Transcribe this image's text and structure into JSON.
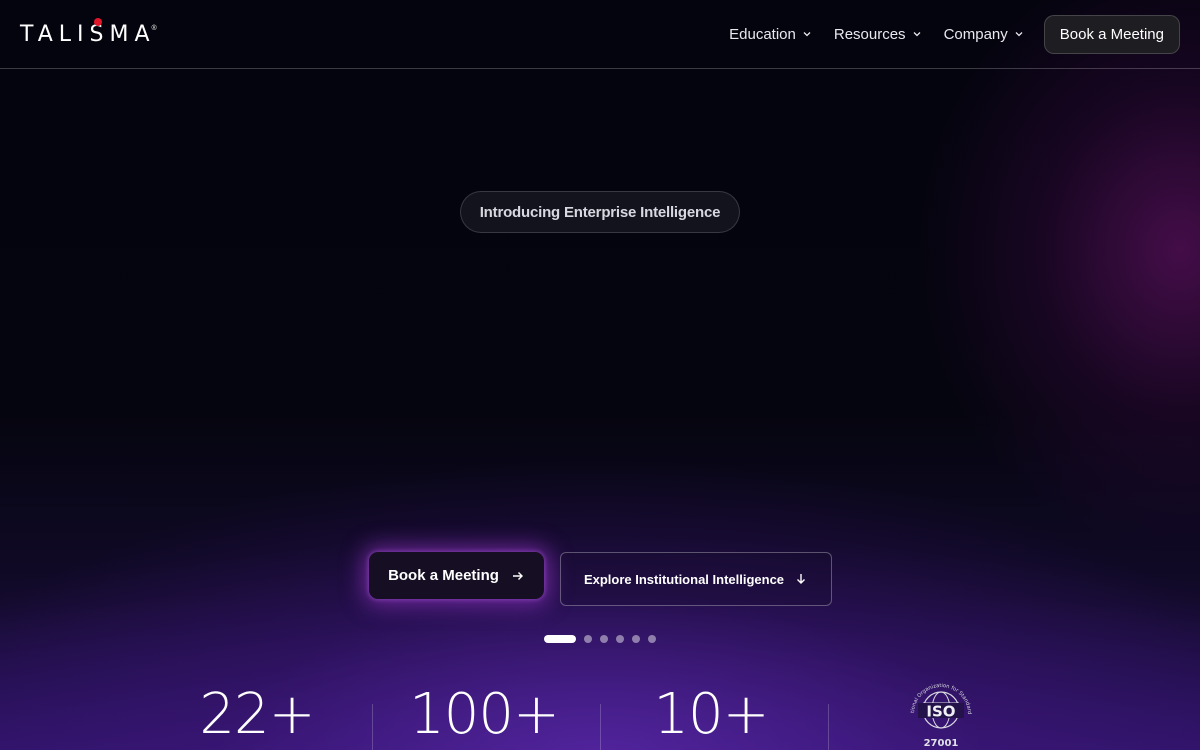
{
  "brand": {
    "name": "TALISMA",
    "registered": "®"
  },
  "nav": {
    "items": [
      {
        "label": "Education",
        "icon": "chevron-down-icon"
      },
      {
        "label": "Resources",
        "icon": "chevron-down-icon"
      },
      {
        "label": "Company",
        "icon": "chevron-down-icon"
      }
    ],
    "cta_label": "Book a Meeting"
  },
  "hero": {
    "badge": "Introducing Enterprise Intelligence",
    "primary_cta": {
      "label": "Book a Meeting",
      "icon": "arrow-right-icon"
    },
    "secondary_cta": {
      "label": "Explore Institutional Intelligence",
      "icon": "arrow-down-icon"
    },
    "carousel": {
      "slides": 6,
      "active": 0
    }
  },
  "stats": [
    {
      "value": "22+"
    },
    {
      "value": "100+"
    },
    {
      "value": "10+"
    }
  ],
  "certification": {
    "label": "ISO",
    "number": "27001",
    "org": "International Organization for Standardization"
  },
  "colors": {
    "accent": "#e2162b",
    "glow": "#aa3cdc",
    "background": "#05050f"
  }
}
